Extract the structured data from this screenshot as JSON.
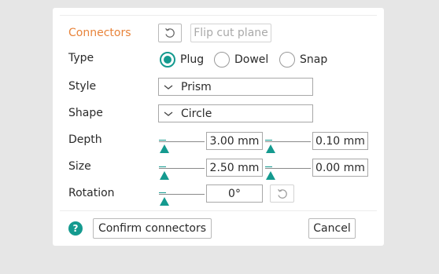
{
  "section": {
    "title": "Connectors"
  },
  "toolbar": {
    "reset_icon": "reset-icon",
    "flip_label": "Flip cut plane"
  },
  "type": {
    "label": "Type",
    "options": [
      "Plug",
      "Dowel",
      "Snap"
    ],
    "selected": "Plug"
  },
  "style": {
    "label": "Style",
    "value": "Prism",
    "icon": "chevron-down-icon"
  },
  "shape": {
    "label": "Shape",
    "value": "Circle",
    "icon": "chevron-down-icon"
  },
  "depth": {
    "label": "Depth",
    "value": "3.00  mm",
    "tolerance": "0.10  mm"
  },
  "size": {
    "label": "Size",
    "value": "2.50  mm",
    "tolerance": "0.00  mm"
  },
  "rotation": {
    "label": "Rotation",
    "value": "0°",
    "reset_icon": "reset-icon"
  },
  "footer": {
    "help_glyph": "?",
    "confirm_label": "Confirm connectors",
    "cancel_label": "Cancel"
  },
  "colors": {
    "accent": "#149a8f",
    "title": "#e8843b",
    "background": "#e6e6e6"
  }
}
